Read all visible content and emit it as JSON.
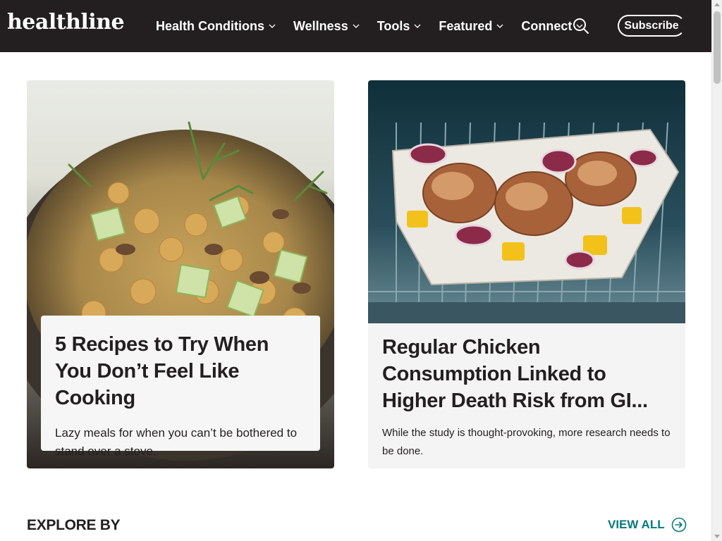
{
  "header": {
    "logo": "healthline",
    "nav": [
      {
        "label": "Health Conditions"
      },
      {
        "label": "Wellness"
      },
      {
        "label": "Tools"
      },
      {
        "label": "Featured"
      },
      {
        "label": "Connect"
      }
    ],
    "search_icon": "search-icon",
    "subscribe_label": "Subscribe"
  },
  "cards": [
    {
      "title": "5 Recipes to Try When You Don’t Feel Like Cooking",
      "description": "Lazy meals for when you can’t be bothered to stand over a stove."
    },
    {
      "title": "Regular Chicken Consumption Linked to Higher Death Risk from GI...",
      "description": "While the study is thought-provoking, more research needs to be done."
    }
  ],
  "explore": {
    "heading": "EXPLORE BY",
    "view_all_label": "VIEW ALL"
  },
  "colors": {
    "header_bg": "#231f20",
    "accent": "#05797e",
    "card_bg": "#f4f4f4"
  }
}
